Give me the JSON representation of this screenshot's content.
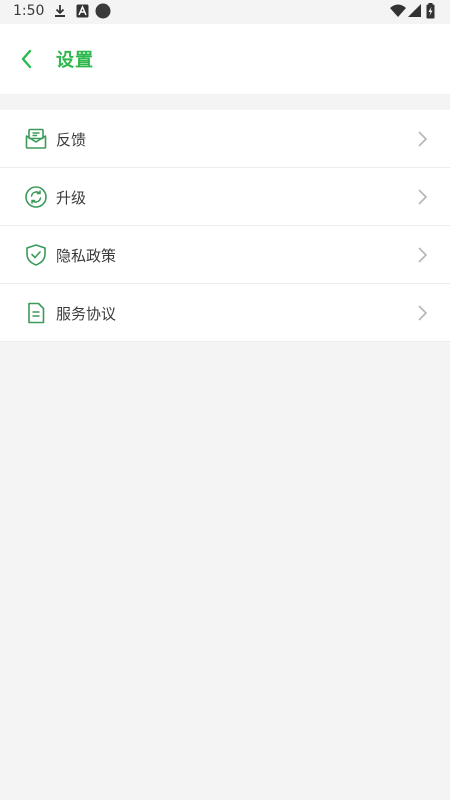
{
  "status_bar": {
    "time": "1:50",
    "icons": [
      "download-icon",
      "notification-a-icon",
      "dot-icon",
      "wifi-icon",
      "signal-icon",
      "battery-icon"
    ]
  },
  "header": {
    "back_icon": "chevron-left-icon",
    "title": "设置"
  },
  "settings": {
    "items": [
      {
        "label": "反馈",
        "icon": "mail-feedback-icon"
      },
      {
        "label": "升级",
        "icon": "refresh-icon"
      },
      {
        "label": "隐私政策",
        "icon": "shield-check-icon"
      },
      {
        "label": "服务协议",
        "icon": "document-icon"
      }
    ]
  },
  "colors": {
    "accent": "#2db84d",
    "icon_green": "#3b9b5a",
    "background": "#f4f4f4"
  }
}
